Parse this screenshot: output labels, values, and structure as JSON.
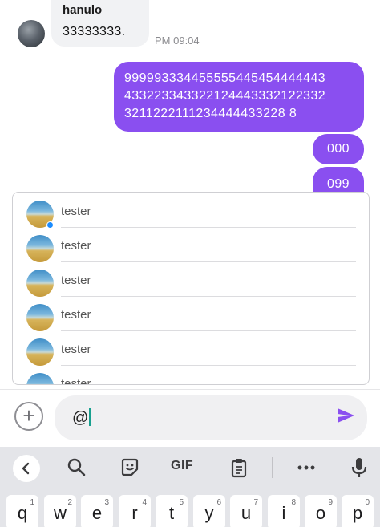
{
  "chat": {
    "incoming": {
      "sender": "hanulo",
      "text": "33333333.",
      "time": "PM 09:04"
    },
    "outgoing": [
      {
        "lines": [
          "999993334455555445454444443",
          "433223343322124443332122332",
          "3211222111234444433228 8"
        ]
      },
      {
        "text": "000"
      },
      {
        "text": "099"
      }
    ]
  },
  "mention_list": {
    "items": [
      {
        "name": "tester",
        "online": true
      },
      {
        "name": "tester"
      },
      {
        "name": "tester"
      },
      {
        "name": "tester"
      },
      {
        "name": "tester"
      },
      {
        "name": "tester"
      }
    ]
  },
  "composer": {
    "value": "@"
  },
  "keyboard": {
    "toolbar": {
      "gif_label": "GIF"
    },
    "keys": [
      {
        "char": "q",
        "num": "1"
      },
      {
        "char": "w",
        "num": "2"
      },
      {
        "char": "e",
        "num": "3"
      },
      {
        "char": "r",
        "num": "4"
      },
      {
        "char": "t",
        "num": "5"
      },
      {
        "char": "y",
        "num": "6"
      },
      {
        "char": "u",
        "num": "7"
      },
      {
        "char": "i",
        "num": "8"
      },
      {
        "char": "o",
        "num": "9"
      },
      {
        "char": "p",
        "num": "0"
      }
    ]
  },
  "colors": {
    "accent": "#8a4ff0",
    "online": "#1a8cff",
    "caret": "#18a08f"
  }
}
